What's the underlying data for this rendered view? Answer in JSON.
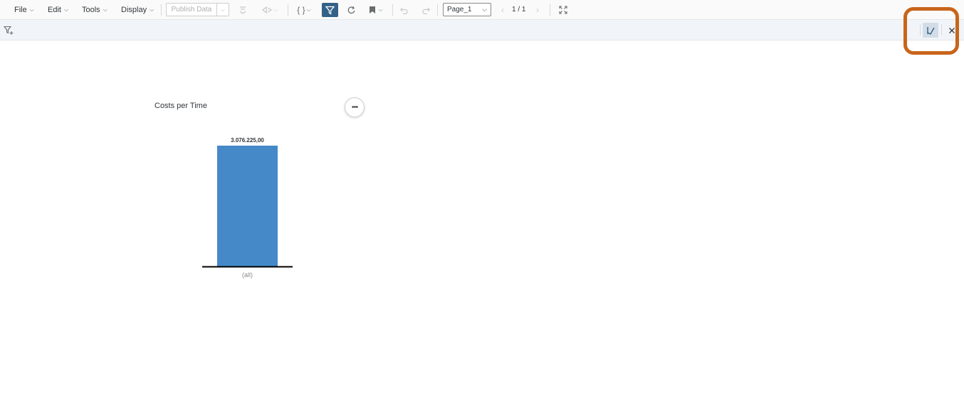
{
  "toolbar": {
    "menus": [
      {
        "label": "File"
      },
      {
        "label": "Edit"
      },
      {
        "label": "Tools"
      },
      {
        "label": "Display"
      }
    ],
    "publish_label": "Publish Data",
    "page_select_value": "Page_1",
    "page_counter": "1 / 1"
  },
  "filterbar": {},
  "widget": {
    "title": "Costs per Time",
    "more_label": "•••"
  },
  "colors": {
    "bar": "#4589c9",
    "active_filter": "#346187",
    "highlight": "#c8651b"
  },
  "chart_data": {
    "type": "bar",
    "categories": [
      "(all)"
    ],
    "values": [
      3076225.0
    ],
    "data_labels": [
      "3.076.225,00"
    ],
    "title": "Costs per Time",
    "xlabel": "",
    "ylabel": "",
    "ylim": [
      0,
      3076225.0
    ],
    "grid": false,
    "legend": "none"
  }
}
